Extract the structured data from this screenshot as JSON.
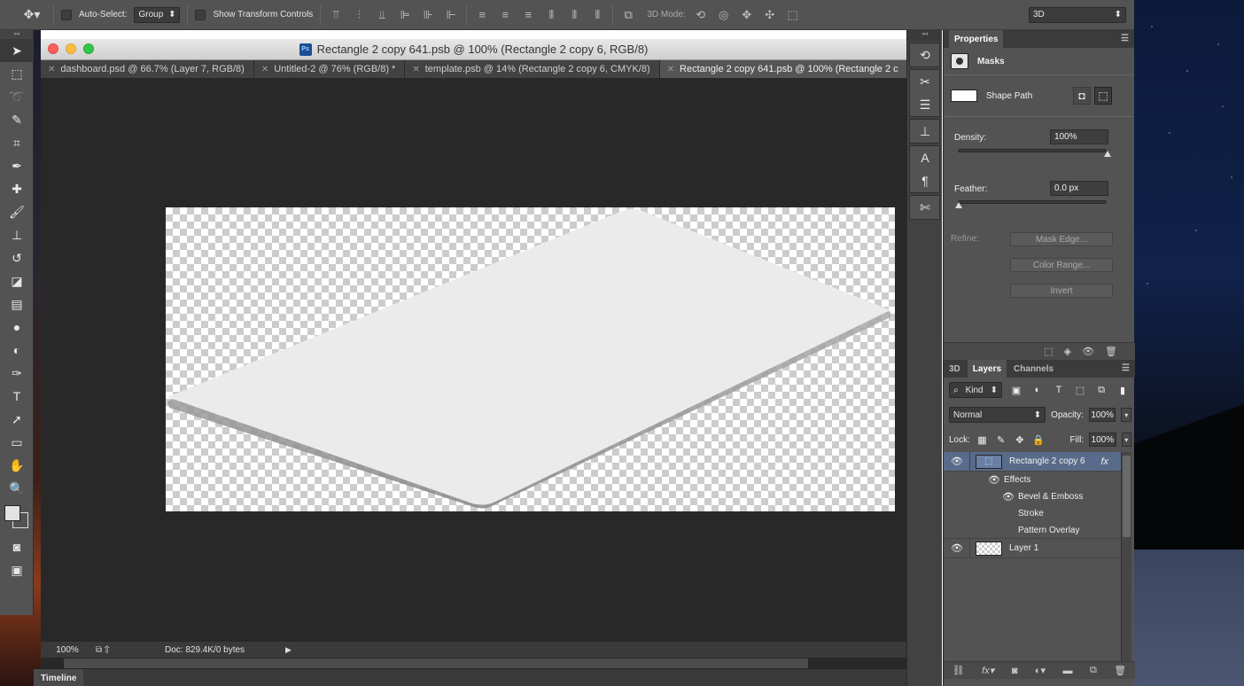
{
  "options_bar": {
    "auto_select_label": "Auto-Select:",
    "auto_select_value": "Group",
    "show_transform_label": "Show Transform Controls",
    "mode_3d_label": "3D Mode:",
    "workspace_value": "3D"
  },
  "browser_url_fragment": "forums.adobe.com/community/postinput.jspa?containerType=14&container=4694",
  "window": {
    "title": "Rectangle 2 copy 641.psb @ 100% (Rectangle 2 copy 6, RGB/8)",
    "tabs": [
      {
        "label": "dashboard.psd @ 66.7% (Layer 7, RGB/8)"
      },
      {
        "label": "Untitled-2 @ 76% (RGB/8) *"
      },
      {
        "label": "template.psb @ 14% (Rectangle 2 copy 6, CMYK/8)"
      },
      {
        "label": "Rectangle 2 copy 641.psb @ 100% (Rectangle 2 c"
      }
    ]
  },
  "status_bar": {
    "zoom": "100%",
    "doc_info": "Doc: 829.4K/0 bytes"
  },
  "timeline": {
    "label": "Timeline"
  },
  "properties": {
    "panel_title": "Properties",
    "section": "Masks",
    "shape_path_label": "Shape Path",
    "density_label": "Density:",
    "density_value": "100%",
    "density_level": 1.0,
    "feather_label": "Feather:",
    "feather_value": "0.0 px",
    "feather_level": 0.0,
    "refine_label": "Refine:",
    "buttons": {
      "mask_edge": "Mask Edge...",
      "color_range": "Color Range...",
      "invert": "Invert"
    }
  },
  "layers_panel": {
    "tabs": [
      {
        "label": "3D"
      },
      {
        "label": "Layers"
      },
      {
        "label": "Channels"
      }
    ],
    "filter_kind": "Kind",
    "blend_mode": "Normal",
    "opacity_label": "Opacity:",
    "opacity_value": "100%",
    "lock_label": "Lock:",
    "fill_label": "Fill:",
    "fill_value": "100%",
    "layers": [
      {
        "name": "Rectangle 2 copy 6",
        "fx": "fx"
      },
      {
        "name": "Layer 1"
      }
    ],
    "effects_label": "Effects",
    "effects": [
      {
        "label": "Bevel & Emboss"
      },
      {
        "label": "Stroke"
      },
      {
        "label": "Pattern Overlay"
      }
    ]
  }
}
